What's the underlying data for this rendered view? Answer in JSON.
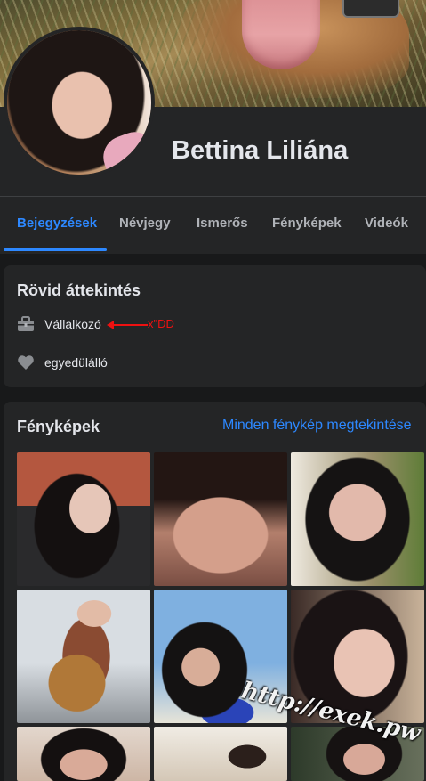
{
  "profile": {
    "name": "Bettina Liliána"
  },
  "tabs": [
    {
      "label": "Bejegyzések",
      "active": true
    },
    {
      "label": "Névjegy",
      "active": false
    },
    {
      "label": "Ismerős",
      "active": false
    },
    {
      "label": "Fényképek",
      "active": false
    },
    {
      "label": "Videók",
      "active": false
    }
  ],
  "intro": {
    "title": "Rövid áttekintés",
    "work": {
      "icon": "briefcase-icon",
      "text": "Vállalkozó"
    },
    "relationship": {
      "icon": "heart-icon",
      "text": "egyedülálló"
    },
    "annotation": "x\"DD"
  },
  "photos": {
    "title": "Fényképek",
    "see_all": "Minden fénykép megtekintése",
    "watermark": "http://exek.pw"
  },
  "colors": {
    "accent": "#2d88ff",
    "background": "#18191a",
    "card": "#242526",
    "text_primary": "#e4e6eb",
    "text_secondary": "#b0b3b8",
    "annotation": "#ee1111"
  }
}
